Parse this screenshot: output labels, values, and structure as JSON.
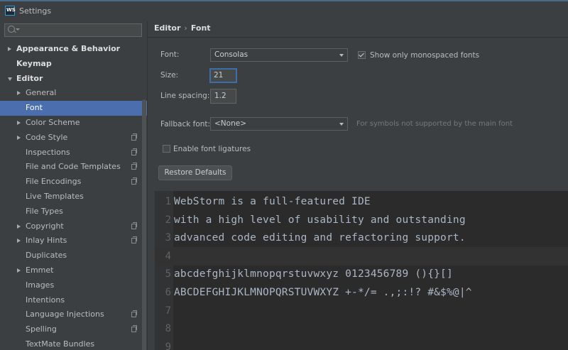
{
  "window": {
    "title": "Settings",
    "logo_text": "WS"
  },
  "search": {
    "value": ""
  },
  "sidebar": {
    "items": [
      {
        "label": "Appearance & Behavior",
        "bold": true,
        "indent": 0,
        "arrow": "right",
        "copy": false,
        "selected": false
      },
      {
        "label": "Keymap",
        "bold": true,
        "indent": 0,
        "arrow": "",
        "copy": false,
        "selected": false
      },
      {
        "label": "Editor",
        "bold": true,
        "indent": 0,
        "arrow": "down",
        "copy": false,
        "selected": false
      },
      {
        "label": "General",
        "bold": false,
        "indent": 1,
        "arrow": "right",
        "copy": false,
        "selected": false
      },
      {
        "label": "Font",
        "bold": false,
        "indent": 1,
        "arrow": "",
        "copy": false,
        "selected": true
      },
      {
        "label": "Color Scheme",
        "bold": false,
        "indent": 1,
        "arrow": "right",
        "copy": false,
        "selected": false
      },
      {
        "label": "Code Style",
        "bold": false,
        "indent": 1,
        "arrow": "right",
        "copy": true,
        "selected": false
      },
      {
        "label": "Inspections",
        "bold": false,
        "indent": 1,
        "arrow": "",
        "copy": true,
        "selected": false
      },
      {
        "label": "File and Code Templates",
        "bold": false,
        "indent": 1,
        "arrow": "",
        "copy": true,
        "selected": false
      },
      {
        "label": "File Encodings",
        "bold": false,
        "indent": 1,
        "arrow": "",
        "copy": true,
        "selected": false
      },
      {
        "label": "Live Templates",
        "bold": false,
        "indent": 1,
        "arrow": "",
        "copy": false,
        "selected": false
      },
      {
        "label": "File Types",
        "bold": false,
        "indent": 1,
        "arrow": "",
        "copy": false,
        "selected": false
      },
      {
        "label": "Copyright",
        "bold": false,
        "indent": 1,
        "arrow": "right",
        "copy": true,
        "selected": false
      },
      {
        "label": "Inlay Hints",
        "bold": false,
        "indent": 1,
        "arrow": "right",
        "copy": true,
        "selected": false
      },
      {
        "label": "Duplicates",
        "bold": false,
        "indent": 1,
        "arrow": "",
        "copy": false,
        "selected": false
      },
      {
        "label": "Emmet",
        "bold": false,
        "indent": 1,
        "arrow": "right",
        "copy": false,
        "selected": false
      },
      {
        "label": "Images",
        "bold": false,
        "indent": 1,
        "arrow": "",
        "copy": false,
        "selected": false
      },
      {
        "label": "Intentions",
        "bold": false,
        "indent": 1,
        "arrow": "",
        "copy": false,
        "selected": false
      },
      {
        "label": "Language Injections",
        "bold": false,
        "indent": 1,
        "arrow": "",
        "copy": true,
        "selected": false
      },
      {
        "label": "Spelling",
        "bold": false,
        "indent": 1,
        "arrow": "",
        "copy": true,
        "selected": false
      },
      {
        "label": "TextMate Bundles",
        "bold": false,
        "indent": 1,
        "arrow": "",
        "copy": false,
        "selected": false
      }
    ]
  },
  "breadcrumb": {
    "parent": "Editor",
    "separator": "›",
    "current": "Font"
  },
  "settings": {
    "font_label": "Font:",
    "font_value": "Consolas",
    "mono_checkbox_label": "Show only monospaced fonts",
    "mono_checked": true,
    "size_label": "Size:",
    "size_value": "21",
    "line_spacing_label": "Line spacing:",
    "line_spacing_value": "1.2",
    "fallback_label": "Fallback font:",
    "fallback_value": "<None>",
    "fallback_hint": "For symbols not supported by the main font",
    "ligatures_label": "Enable font ligatures",
    "ligatures_checked": false,
    "restore_button": "Restore Defaults"
  },
  "preview": {
    "current_line": 4,
    "lines": [
      {
        "no": "1",
        "text": "WebStorm is a full-featured IDE"
      },
      {
        "no": "2",
        "text": "with a high level of usability and outstanding"
      },
      {
        "no": "3",
        "text": "advanced code editing and refactoring support."
      },
      {
        "no": "4",
        "text": ""
      },
      {
        "no": "5",
        "text": "abcdefghijklmnopqrstuvwxyz 0123456789 (){}[]"
      },
      {
        "no": "6",
        "text": "ABCDEFGHIJKLMNOPQRSTUVWXYZ +-*/= .,;:!? #&$%@|^"
      },
      {
        "no": "7",
        "text": ""
      },
      {
        "no": "8",
        "text": ""
      },
      {
        "no": "9",
        "text": ""
      }
    ]
  },
  "colors": {
    "selection": "#4b6eaf",
    "background": "#3c3f41",
    "editor_bg": "#2b2b2b",
    "code_text": "#a9b7c6"
  }
}
